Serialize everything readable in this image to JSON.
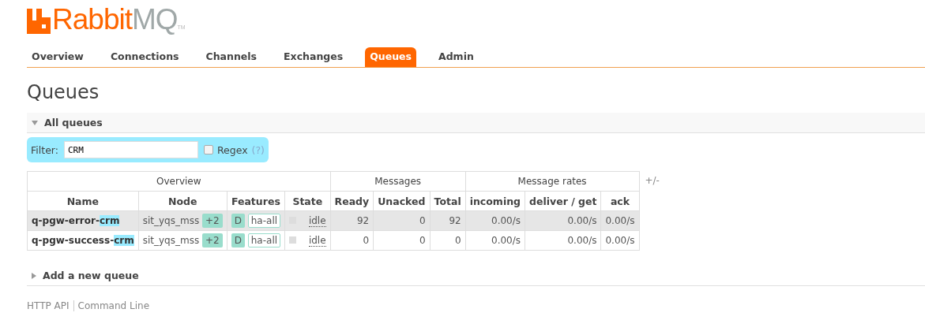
{
  "logo": {
    "brand": "Rabbit",
    "product": "MQ",
    "mark": "TM"
  },
  "nav": [
    {
      "label": "Overview",
      "selected": false
    },
    {
      "label": "Connections",
      "selected": false
    },
    {
      "label": "Channels",
      "selected": false
    },
    {
      "label": "Exchanges",
      "selected": false
    },
    {
      "label": "Queues",
      "selected": true
    },
    {
      "label": "Admin",
      "selected": false
    }
  ],
  "heading": "Queues",
  "section": {
    "title": "All queues",
    "expanded": true
  },
  "filter": {
    "label": "Filter:",
    "value": "CRM",
    "regex_label": "Regex",
    "regex_checked": false,
    "help": "(?)"
  },
  "table": {
    "groups": [
      {
        "label": "Overview",
        "columns": [
          "Name",
          "Node",
          "Features",
          "State"
        ]
      },
      {
        "label": "Messages",
        "columns": [
          "Ready",
          "Unacked",
          "Total"
        ]
      },
      {
        "label": "Message rates",
        "columns": [
          "incoming",
          "deliver / get",
          "ack"
        ]
      }
    ],
    "toggle": "+/-",
    "rows": [
      {
        "name": "q-pgw-error-",
        "match": "crm",
        "node": "sit_yqs_mss",
        "node_extra": "+2",
        "durable": "D",
        "policy": "ha-all",
        "state": "idle",
        "ready": "92",
        "unacked": "0",
        "total": "92",
        "incoming": "0.00/s",
        "deliver_get": "0.00/s",
        "ack": "0.00/s",
        "highlighted": true
      },
      {
        "name": "q-pgw-success-",
        "match": "crm",
        "node": "sit_yqs_mss",
        "node_extra": "+2",
        "durable": "D",
        "policy": "ha-all",
        "state": "idle",
        "ready": "0",
        "unacked": "0",
        "total": "0",
        "incoming": "0.00/s",
        "deliver_get": "0.00/s",
        "ack": "0.00/s",
        "highlighted": false
      }
    ]
  },
  "add_section": {
    "title": "Add a new queue",
    "expanded": false
  },
  "footer": [
    "HTTP API",
    "Command Line"
  ]
}
